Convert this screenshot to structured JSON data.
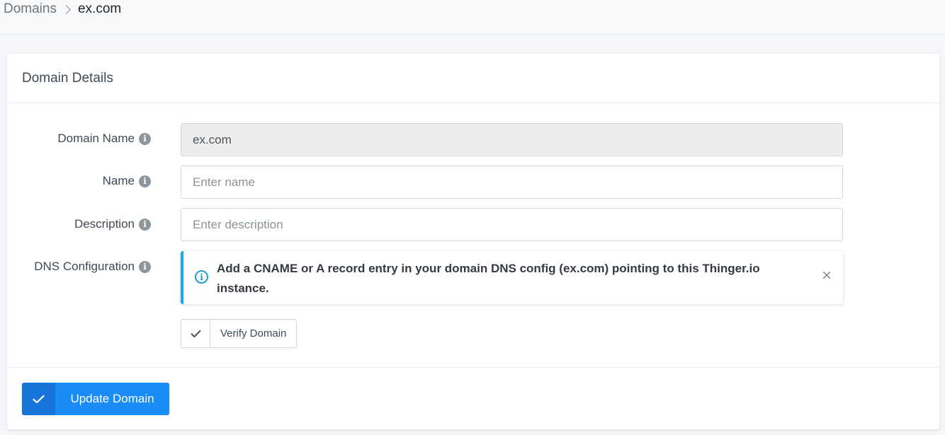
{
  "breadcrumb": {
    "parent": "Domains",
    "current": "ex.com"
  },
  "card": {
    "title": "Domain Details"
  },
  "form": {
    "domain_name": {
      "label": "Domain Name",
      "value": "ex.com"
    },
    "name": {
      "label": "Name",
      "value": "",
      "placeholder": "Enter name"
    },
    "description": {
      "label": "Description",
      "value": "",
      "placeholder": "Enter description"
    },
    "dns": {
      "label": "DNS Configuration",
      "alert_text": "Add a CNAME or A record entry in your domain DNS config (ex.com) pointing to this Thinger.io instance.",
      "close_glyph": "×"
    }
  },
  "buttons": {
    "verify_label": "Verify Domain",
    "update_label": "Update Domain"
  },
  "icons": {
    "info_glyph": "i",
    "check_icon": "check-icon"
  },
  "colors": {
    "primary": "#1a8cf5",
    "primary_dark": "#1675d8",
    "alert_accent": "#1aa8e6"
  }
}
